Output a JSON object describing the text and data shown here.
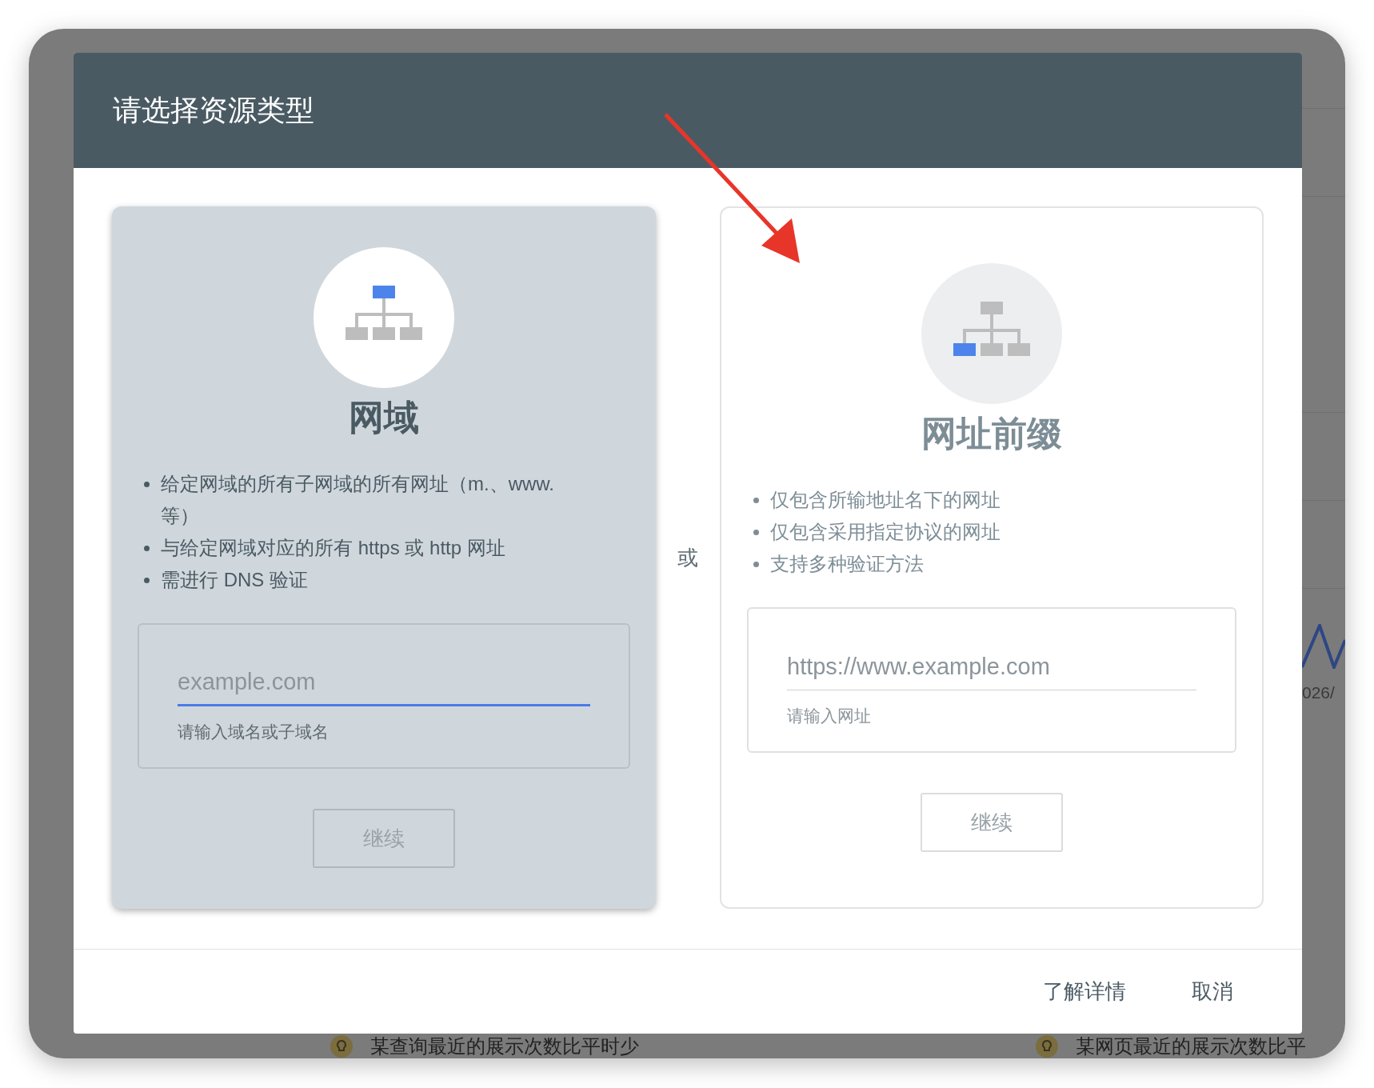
{
  "background": {
    "chart_label": "026/",
    "alerts": [
      {
        "text": "某查询最近的展示次数比平时少"
      },
      {
        "text": "某网页最近的展示次数比平"
      }
    ]
  },
  "dialog": {
    "title": "请选择资源类型",
    "options": [
      {
        "kind": "domain",
        "selected": true,
        "title": "网域",
        "bullets": [
          "给定网域的所有子网域的所有网址（m.、www. 等）",
          "与给定网域对应的所有 https 或 http 网址",
          "需进行 DNS 验证"
        ],
        "input": {
          "placeholder": "example.com",
          "helper": "请输入域名或子域名",
          "focused": true
        },
        "button": "继续"
      },
      {
        "kind": "url_prefix",
        "selected": false,
        "title": "网址前缀",
        "bullets": [
          "仅包含所输地址名下的网址",
          "仅包含采用指定协议的网址",
          "支持多种验证方法"
        ],
        "input": {
          "placeholder": "https://www.example.com",
          "helper": "请输入网址",
          "focused": false
        },
        "button": "继续"
      }
    ],
    "separator": "或",
    "footer_buttons": [
      "了解详情",
      "取消"
    ]
  }
}
